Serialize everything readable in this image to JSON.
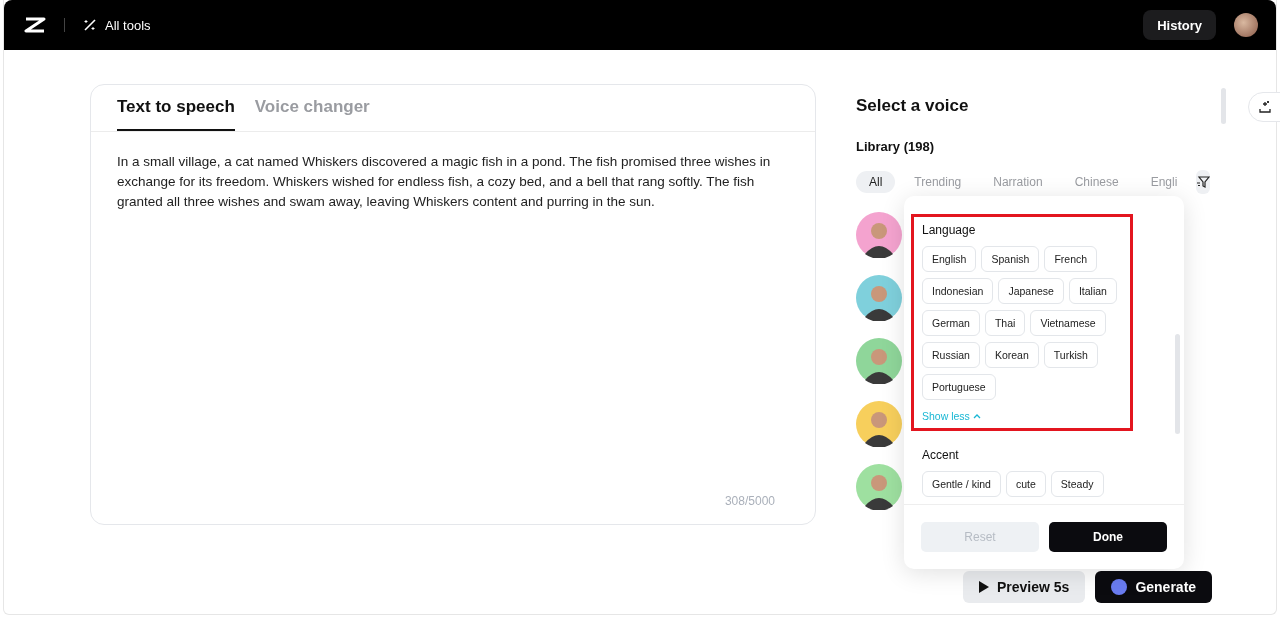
{
  "header": {
    "all_tools": "All tools",
    "history": "History"
  },
  "editor": {
    "tabs": [
      {
        "label": "Text to speech",
        "selected": true
      },
      {
        "label": "Voice changer",
        "selected": false
      }
    ],
    "text": "In a small village, a cat named Whiskers discovered a magic fish in a pond. The fish promised three wishes in exchange for its freedom. Whiskers wished for endless fish, a cozy bed, and a bell that rang softly. The fish granted all three wishes and swam away, leaving Whiskers content and purring in the sun.",
    "counter": "308/5000"
  },
  "voices": {
    "title": "Select a voice",
    "library": "Library (198)",
    "categories": [
      {
        "label": "All",
        "selected": true
      },
      {
        "label": "Trending",
        "selected": false
      },
      {
        "label": "Narration",
        "selected": false
      },
      {
        "label": "Chinese",
        "selected": false
      },
      {
        "label": "Engli",
        "selected": false
      }
    ],
    "avatars": [
      {
        "color": "#f4a3cf"
      },
      {
        "color": "#7fd0dc"
      },
      {
        "color": "#8fd69a"
      },
      {
        "color": "#f7cf5c"
      },
      {
        "color": "#9ee0a0"
      }
    ],
    "actions": [
      {
        "label": "Preview 5s",
        "kind": "preview"
      },
      {
        "label": "Generate",
        "kind": "generate"
      }
    ]
  },
  "filter": {
    "sections": [
      {
        "title": "Language",
        "highlighted": true,
        "options": [
          "English",
          "Spanish",
          "French",
          "Indonesian",
          "Japanese",
          "Italian",
          "German",
          "Thai",
          "Vietnamese",
          "Russian",
          "Korean",
          "Turkish",
          "Portuguese"
        ],
        "toggle": "Show less"
      },
      {
        "title": "Accent",
        "highlighted": false,
        "options": [
          "Gentle / kind",
          "cute",
          "Steady"
        ]
      }
    ],
    "reset": {
      "label": "Reset",
      "disabled": true
    },
    "done": {
      "label": "Done"
    }
  }
}
